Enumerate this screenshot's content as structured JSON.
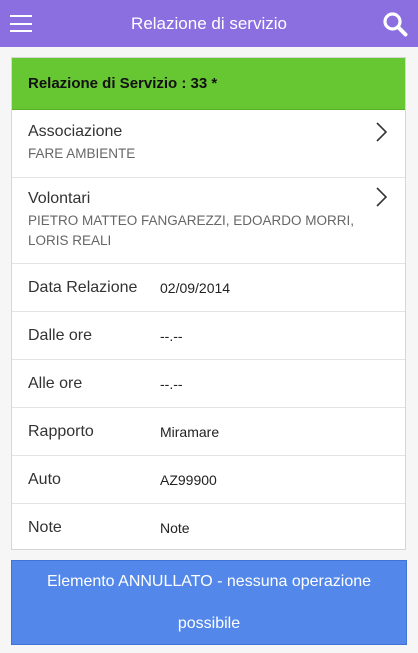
{
  "header": {
    "title": "Relazione di servizio",
    "bg_color": "#8b6fe0"
  },
  "card": {
    "title": "Relazione di Servizio : 33 *",
    "title_bg_color": "#67c733",
    "associazione": {
      "label": "Associazione",
      "value": "FARE AMBIENTE"
    },
    "volontari": {
      "label": "Volontari",
      "value": "PIETRO MATTEO FANGAREZZI, EDOARDO MORRI, LORIS REALI"
    },
    "fields": [
      {
        "label": "Data Relazione",
        "value": "02/09/2014"
      },
      {
        "label": "Dalle ore",
        "value": "--.--"
      },
      {
        "label": "Alle ore",
        "value": "--.--"
      },
      {
        "label": "Rapporto",
        "value": "Miramare"
      },
      {
        "label": "Auto",
        "value": "AZ99900"
      },
      {
        "label": "Note",
        "value": "Note"
      }
    ]
  },
  "status_button": {
    "label": "Elemento ANNULLATO - nessuna operazione possibile",
    "bg_color": "#5388ea"
  },
  "icons": [
    "menu-icon",
    "search-icon",
    "chevron-right-icon"
  ]
}
